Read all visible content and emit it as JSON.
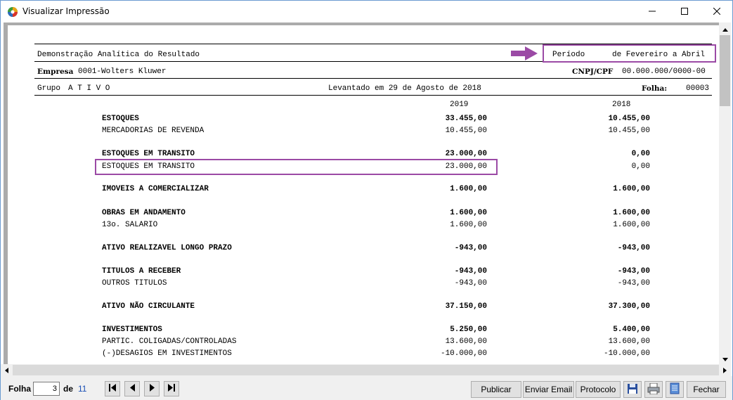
{
  "window": {
    "title": "Visualizar Impressão",
    "controls": {
      "minimize": "minimize-icon",
      "maximize": "maximize-icon",
      "close": "close-icon"
    }
  },
  "report": {
    "title": "Demonstração Analítica do Resultado",
    "periodo_label": "Período",
    "periodo_value": "de Fevereiro a Abril",
    "empresa_label": "Empresa",
    "empresa_value": "0001-Wolters Kluwer",
    "cnpj_label": "CNPJ/CPF",
    "cnpj_value": "00.000.000/0000-00",
    "grupo_label": "Grupo",
    "grupo_value": "A T I V O",
    "levantado": "Levantado em 29 de Agosto de 2018",
    "folha_label": "Folha:",
    "folha_value": "00003",
    "col_year_1": "2019",
    "col_year_2": "2018",
    "rows": [
      {
        "label": "ESTOQUES",
        "v1": "33.455,00",
        "v2": "10.455,00",
        "bold": true
      },
      {
        "label": "MERCADORIAS DE REVENDA",
        "v1": "10.455,00",
        "v2": "10.455,00",
        "bold": false
      },
      {
        "label": "ESTOQUES EM TRANSITO",
        "v1": "23.000,00",
        "v2": "0,00",
        "bold": true
      },
      {
        "label": "ESTOQUES EM TRANSITO",
        "v1": "23.000,00",
        "v2": "0,00",
        "bold": false
      },
      {
        "label": "IMOVEIS A COMERCIALIZAR",
        "v1": "1.600,00",
        "v2": "1.600,00",
        "bold": true
      },
      {
        "label": "OBRAS EM ANDAMENTO",
        "v1": "1.600,00",
        "v2": "1.600,00",
        "bold": true
      },
      {
        "label": "13o. SALARIO",
        "v1": "1.600,00",
        "v2": "1.600,00",
        "bold": false
      },
      {
        "label": "ATIVO REALIZAVEL LONGO PRAZO",
        "v1": "-943,00",
        "v2": "-943,00",
        "bold": true
      },
      {
        "label": "TITULOS A RECEBER",
        "v1": "-943,00",
        "v2": "-943,00",
        "bold": true
      },
      {
        "label": "OUTROS TITULOS",
        "v1": "-943,00",
        "v2": "-943,00",
        "bold": false
      },
      {
        "label": "ATIVO NÃO CIRCULANTE",
        "v1": "37.150,00",
        "v2": "37.300,00",
        "bold": true
      },
      {
        "label": "INVESTIMENTOS",
        "v1": "5.250,00",
        "v2": "5.400,00",
        "bold": true
      },
      {
        "label": "PARTIC. COLIGADAS/CONTROLADAS",
        "v1": "13.600,00",
        "v2": "13.600,00",
        "bold": false
      },
      {
        "label": "(-)DESAGIOS EM INVESTIMENTOS",
        "v1": "-10.000,00",
        "v2": "-10.000,00",
        "bold": false
      }
    ]
  },
  "annotation": {
    "color": "#9b4aa5"
  },
  "footer": {
    "folha_label": "Folha",
    "folha_input_value": "3",
    "de_label": "de",
    "total_pages": "11",
    "nav_icons": [
      "first-page-icon",
      "previous-page-icon",
      "next-page-icon",
      "last-page-icon"
    ],
    "buttons": {
      "publicar": "Publicar",
      "enviar_email": "Enviar Email",
      "protocolo": "Protocolo",
      "fechar": "Fechar"
    },
    "icon_buttons": [
      "save-icon",
      "print-icon",
      "document-icon"
    ]
  }
}
